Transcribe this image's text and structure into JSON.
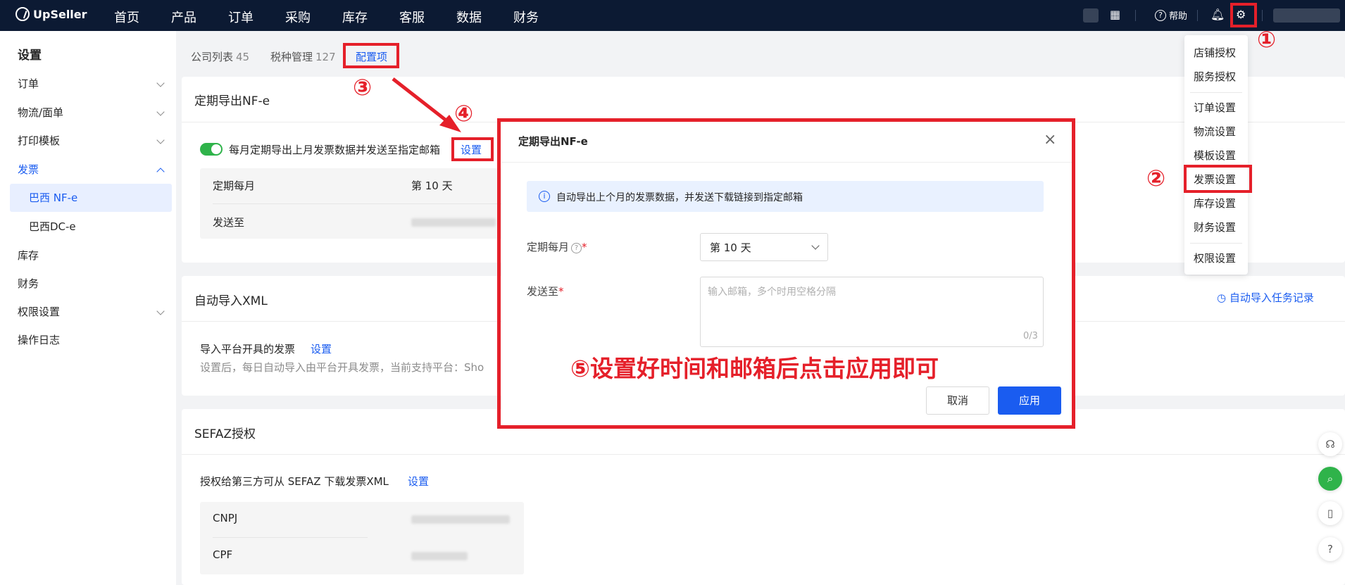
{
  "topbar": {
    "brand": "UpSeller",
    "nav": [
      "首页",
      "产品",
      "订单",
      "采购",
      "库存",
      "客服",
      "数据",
      "财务"
    ],
    "help": "帮助"
  },
  "sidebar": {
    "title": "设置",
    "items": [
      "订单",
      "物流/面单",
      "打印模板",
      "发票",
      "巴西 NF-e",
      "巴西DC-e",
      "库存",
      "财务",
      "权限设置",
      "操作日志"
    ]
  },
  "tabs": {
    "company_list": "公司列表",
    "company_count": "45",
    "tax_manage": "税种管理",
    "tax_count": "127",
    "config": "配置项"
  },
  "card_nfe": {
    "title": "定期导出NF-e",
    "toggle_text": "每月定期导出上月发票数据并发送至指定邮箱",
    "settings_link": "设置",
    "row1_label": "定期每月",
    "row1_value": "第 10 天",
    "row2_label": "发送至"
  },
  "card_xml": {
    "title": "自动导入XML",
    "task_record": "自动导入任务记录",
    "import_label": "导入平台开具的发票",
    "settings_link": "设置",
    "desc": "设置后，每日自动导入由平台开具发票，当前支持平台：Sho"
  },
  "card_sefaz": {
    "title": "SEFAZ授权",
    "auth_text": "授权给第三方可从 SEFAZ 下载发票XML",
    "settings_link": "设置",
    "cnpj": "CNPJ",
    "cpf": "CPF"
  },
  "dropdown": {
    "items": [
      "店铺授权",
      "服务授权",
      "订单设置",
      "物流设置",
      "模板设置",
      "发票设置",
      "库存设置",
      "财务设置",
      "权限设置"
    ]
  },
  "modal": {
    "title": "定期导出NF-e",
    "close": "×",
    "alert": "自动导出上个月的发票数据，并发送下载链接到指定邮箱",
    "field1_label": "定期每月",
    "field1_value": "第 10 天",
    "field2_label": "发送至",
    "email_placeholder": "输入邮箱，多个时用空格分隔",
    "count": "0/3",
    "cancel": "取消",
    "apply": "应用"
  },
  "annotations": {
    "n1": "①",
    "n2": "②",
    "n3": "③",
    "n4": "④",
    "instruction": "⑤设置好时间和邮箱后点击应用即可"
  },
  "colors": {
    "accent": "#1a5cf0",
    "annotation": "#e5202a",
    "nav_bg": "#0c1a33",
    "toggle": "#2fb34a"
  }
}
